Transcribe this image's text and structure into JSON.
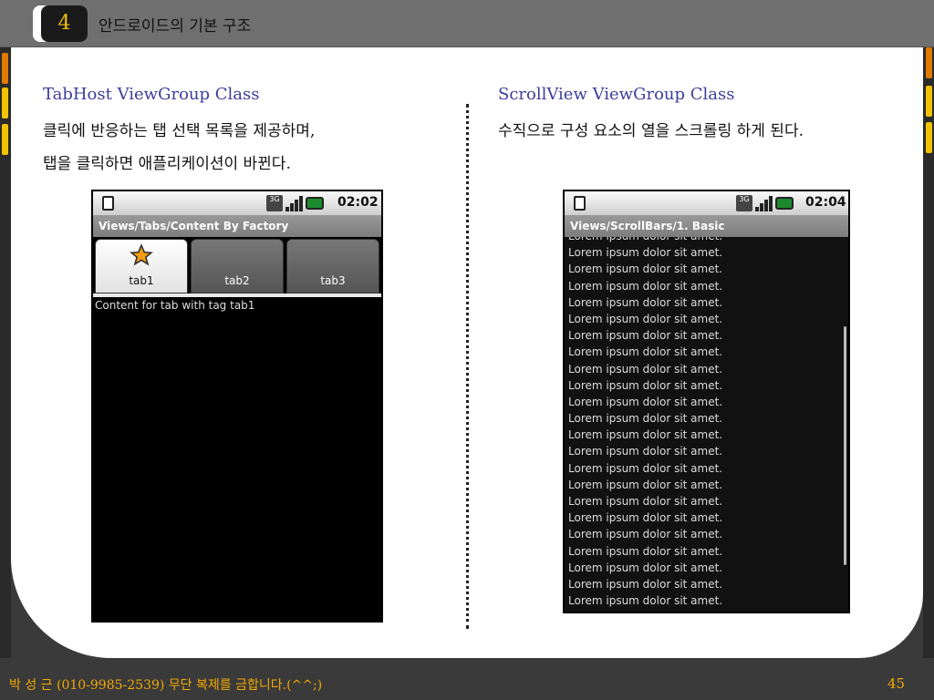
{
  "header": {
    "number": "4",
    "title": "안드로이드의 기본 구조"
  },
  "left_section": {
    "title": "TabHost ViewGroup Class",
    "desc_line1": "클릭에 반응하는 탭 선택 목록을 제공하며,",
    "desc_line2": "탭을 클릭하면 애플리케이션이 바뀐다."
  },
  "right_section": {
    "title": "ScrollView ViewGroup Class",
    "desc_line1": "수직으로 구성 요소의 열을 스크롤링 하게 된다."
  },
  "phone_tabs": {
    "time": "02:02",
    "network": "3G",
    "title": "Views/Tabs/Content By Factory",
    "tabs": [
      {
        "label": "tab1"
      },
      {
        "label": "tab2"
      },
      {
        "label": "tab3"
      }
    ],
    "content": "Content for tab with tag tab1"
  },
  "phone_scroll": {
    "time": "02:04",
    "network": "3G",
    "title": "Views/ScrollBars/1. Basic",
    "line_text": "Lorem ipsum dolor sit amet.",
    "lines": [
      "Lorem ipsum dolor sit amet.",
      "Lorem ipsum dolor sit amet.",
      "Lorem ipsum dolor sit amet.",
      "Lorem ipsum dolor sit amet.",
      "Lorem ipsum dolor sit amet.",
      "Lorem ipsum dolor sit amet.",
      "Lorem ipsum dolor sit amet.",
      "Lorem ipsum dolor sit amet.",
      "Lorem ipsum dolor sit amet.",
      "Lorem ipsum dolor sit amet.",
      "Lorem ipsum dolor sit amet.",
      "Lorem ipsum dolor sit amet.",
      "Lorem ipsum dolor sit amet.",
      "Lorem ipsum dolor sit amet.",
      "Lorem ipsum dolor sit amet.",
      "Lorem ipsum dolor sit amet.",
      "Lorem ipsum dolor sit amet.",
      "Lorem ipsum dolor sit amet.",
      "Lorem ipsum dolor sit amet.",
      "Lorem ipsum dolor sit amet.",
      "Lorem ipsum dolor sit amet.",
      "Lorem ipsum dolor sit amet.",
      "Lorem ipsum dolor sit amet."
    ]
  },
  "footer": {
    "text": "박 성 근 (010-9985-2539)  무단 복제를 금합니다.(^^;)",
    "page": "45"
  },
  "colors": {
    "accent": "#f2a900",
    "section_title": "#3d3d99",
    "side_tab_orange": "#e07a00",
    "side_tab_yellow": "#f2c200"
  }
}
